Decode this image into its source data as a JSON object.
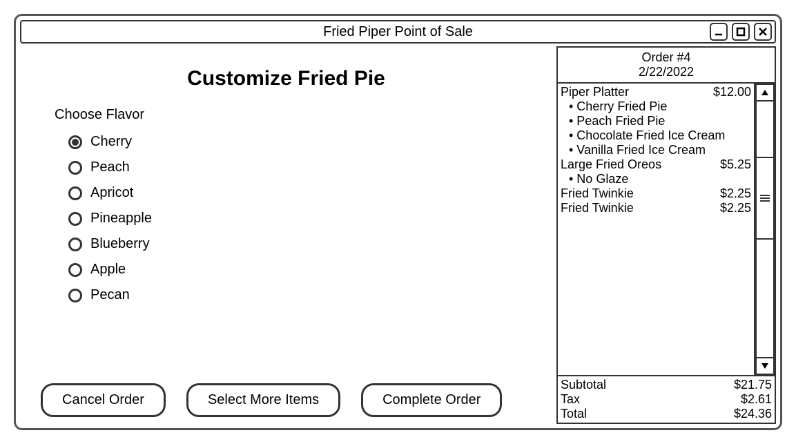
{
  "window": {
    "title": "Fried Piper Point of Sale"
  },
  "customize": {
    "title": "Customize Fried Pie",
    "section_label": "Choose Flavor",
    "options": [
      {
        "label": "Cherry",
        "selected": true
      },
      {
        "label": "Peach",
        "selected": false
      },
      {
        "label": "Apricot",
        "selected": false
      },
      {
        "label": "Pineapple",
        "selected": false
      },
      {
        "label": "Blueberry",
        "selected": false
      },
      {
        "label": "Apple",
        "selected": false
      },
      {
        "label": "Pecan",
        "selected": false
      }
    ]
  },
  "actions": {
    "cancel": "Cancel Order",
    "more": "Select More Items",
    "complete": "Complete Order"
  },
  "order": {
    "header_line1": "Order #4",
    "header_line2": "2/22/2022",
    "items": [
      {
        "name": "Piper Platter",
        "price": "$12.00",
        "subs": [
          "Cherry Fried Pie",
          "Peach Fried Pie",
          "Chocolate Fried Ice Cream",
          "Vanilla Fried Ice Cream"
        ]
      },
      {
        "name": "Large Fried Oreos",
        "price": "$5.25",
        "subs": [
          "No Glaze"
        ]
      },
      {
        "name": "Fried Twinkie",
        "price": "$2.25",
        "subs": []
      },
      {
        "name": "Fried Twinkie",
        "price": "$2.25",
        "subs": []
      }
    ],
    "totals": {
      "subtotal_label": "Subtotal",
      "subtotal_value": "$21.75",
      "tax_label": "Tax",
      "tax_value": "$2.61",
      "total_label": "Total",
      "total_value": "$24.36"
    }
  }
}
